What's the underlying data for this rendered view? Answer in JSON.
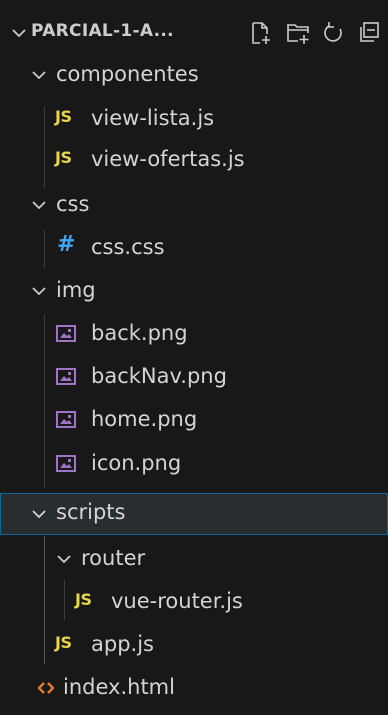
{
  "header": {
    "title": "PARCIAL-1-A...",
    "icons": [
      "new-file-icon",
      "new-folder-icon",
      "refresh-icon",
      "collapse-all-icon"
    ]
  },
  "tree": {
    "componentes": "componentes",
    "view_lista": "view-lista.js",
    "view_ofertas": "view-ofertas.js",
    "css_folder": "css",
    "css_file": "css.css",
    "img_folder": "img",
    "back": "back.png",
    "backNav": "backNav.png",
    "home": "home.png",
    "icon": "icon.png",
    "scripts": "scripts",
    "router": "router",
    "vue_router": "vue-router.js",
    "app": "app.js",
    "index": "index.html"
  },
  "badges": {
    "js": "JS",
    "css": "#"
  },
  "colors": {
    "background": "#181818",
    "text": "#cccccc",
    "js_badge": "#e8d44d",
    "css_hash": "#42a5f5",
    "image_icon": "#a074c4",
    "html_icon": "#e37933",
    "selection_border": "#0e639c"
  }
}
